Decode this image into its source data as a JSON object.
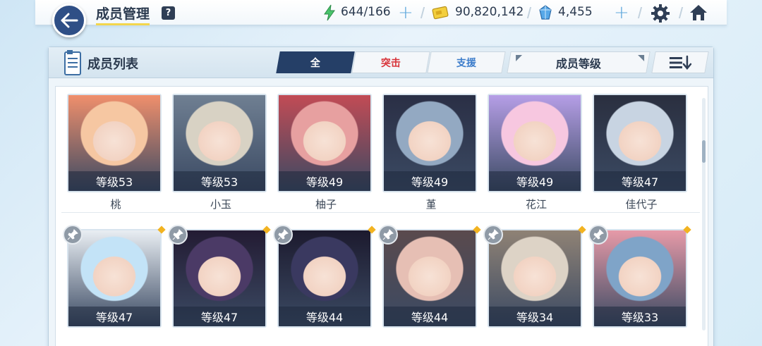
{
  "header": {
    "title": "成员管理",
    "help_label": "?",
    "ap": "644/166",
    "credits": "90,820,142",
    "pyroxene": "4,455",
    "plus_label": "+"
  },
  "panel": {
    "title": "成员列表",
    "tabs": [
      {
        "label": "全",
        "active": true
      },
      {
        "label": "突击",
        "active": false
      },
      {
        "label": "支援",
        "active": false
      }
    ],
    "sort_label": "成员等级"
  },
  "members": [
    {
      "name": "桃",
      "level": "等级53",
      "art_colors": [
        "#f6c7a2",
        "#f08f6c"
      ],
      "pinned_visible": false
    },
    {
      "name": "小玉",
      "level": "等级53",
      "art_colors": [
        "#d8d2c4",
        "#6f7f92"
      ],
      "pinned_visible": false
    },
    {
      "name": "柚子",
      "level": "等级49",
      "art_colors": [
        "#e7a0a0",
        "#c24b55"
      ],
      "pinned_visible": false
    },
    {
      "name": "堇",
      "level": "等级49",
      "art_colors": [
        "#93a9c2",
        "#2a2f45"
      ],
      "pinned_visible": false
    },
    {
      "name": "花江",
      "level": "等级49",
      "art_colors": [
        "#f7c7e0",
        "#b59ee6"
      ],
      "pinned_visible": false
    },
    {
      "name": "佳代子",
      "level": "等级47",
      "art_colors": [
        "#c8d4e2",
        "#2a2f3f"
      ],
      "pinned_visible": false
    },
    {
      "name": "",
      "level": "等级47",
      "art_colors": [
        "#c3e3f7",
        "#e9eef3"
      ],
      "pinned_visible": true
    },
    {
      "name": "",
      "level": "等级47",
      "art_colors": [
        "#4b3a66",
        "#231b33"
      ],
      "pinned_visible": true
    },
    {
      "name": "",
      "level": "等级44",
      "art_colors": [
        "#3a3960",
        "#1c1a2e"
      ],
      "pinned_visible": true
    },
    {
      "name": "",
      "level": "等级44",
      "art_colors": [
        "#e6bfb4",
        "#5a4a4d"
      ],
      "pinned_visible": true
    },
    {
      "name": "",
      "level": "等级34",
      "art_colors": [
        "#ddd3c6",
        "#8f8275"
      ],
      "pinned_visible": true
    },
    {
      "name": "",
      "level": "等级33",
      "art_colors": [
        "#7fa4c8",
        "#e69aa8"
      ],
      "pinned_visible": true
    }
  ],
  "colors": {
    "accent_dark": "#253f67",
    "strike_red": "#d8343a",
    "support_blue": "#3d7dcb",
    "new_marker": "#f2b321"
  }
}
